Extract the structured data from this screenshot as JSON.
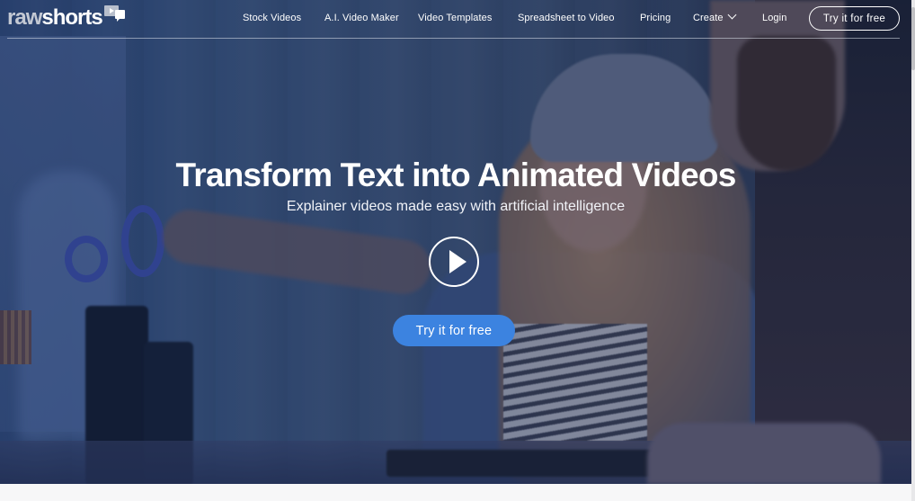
{
  "brand": {
    "logo_part1": "raw",
    "logo_part2": "shorts",
    "logo_icon": "chat-play-icon"
  },
  "nav": {
    "items": [
      {
        "label": "Stock Videos"
      },
      {
        "label": "A.I. Video Maker"
      },
      {
        "label": "Video Templates"
      },
      {
        "label": "Spreadsheet to Video"
      },
      {
        "label": "Pricing"
      },
      {
        "label": "Create",
        "icon": "chevron-down-icon"
      },
      {
        "label": "Login"
      }
    ],
    "cta_label": "Try it for free"
  },
  "hero": {
    "headline": "Transform Text into Animated Videos",
    "subheadline": "Explainer videos made easy with artificial intelligence",
    "play_icon": "play-icon",
    "cta_label": "Try it for free"
  },
  "colors": {
    "accent": "#3c83e0",
    "overlay": "#1a2c54",
    "text": "#ffffff"
  }
}
